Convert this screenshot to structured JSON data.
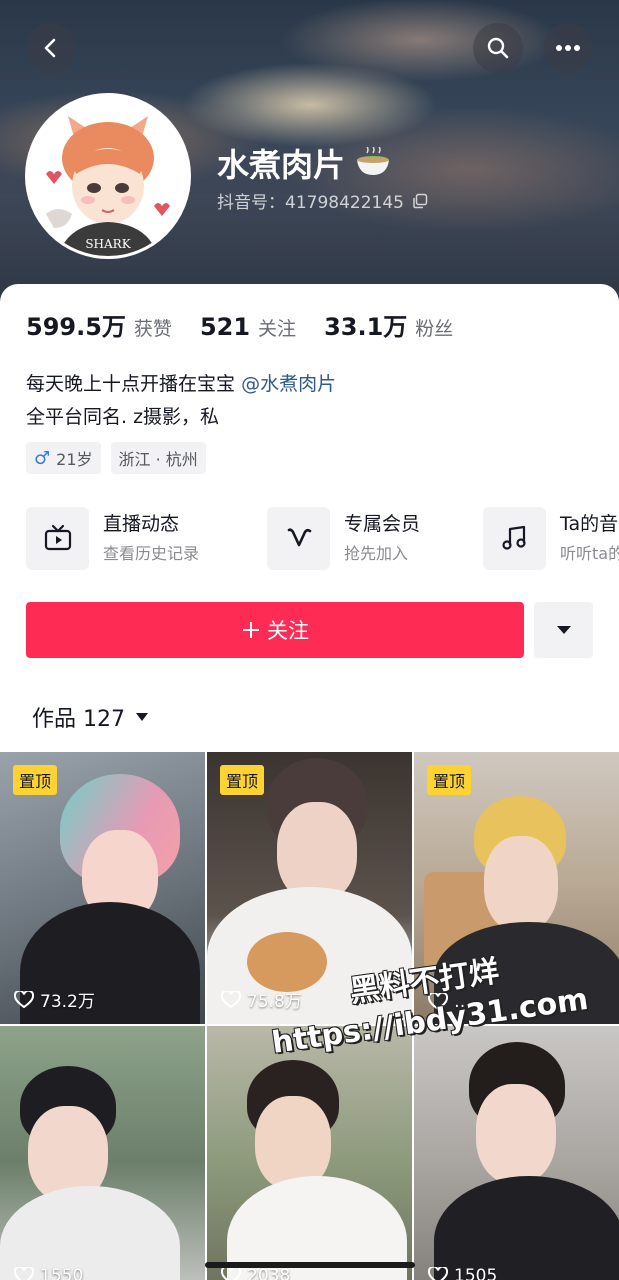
{
  "header": {
    "back_icon": "chevron-left-icon",
    "search_icon": "search-icon",
    "more_icon": "ellipsis-icon"
  },
  "profile": {
    "nickname": "水煮肉片",
    "douyin_id": "抖音号：41798422145",
    "avatar_text": "SHARK"
  },
  "stats": [
    {
      "value": "599.5万",
      "label": "获赞"
    },
    {
      "value": "521",
      "label": "关注"
    },
    {
      "value": "33.1万",
      "label": "粉丝"
    }
  ],
  "bio": {
    "line1_text": "每天晚上十点开播在宝宝",
    "line1_mention": "@水煮肉片",
    "line2": "全平台同名. z摄影，私"
  },
  "tags": [
    {
      "icon": "male-icon",
      "text": "21岁"
    },
    {
      "text": "浙江 · 杭州"
    }
  ],
  "features": [
    {
      "icon": "tv-icon",
      "title": "直播动态",
      "sub": "查看历史记录"
    },
    {
      "icon": "vip-icon",
      "title": "专属会员",
      "sub": "抢先加入"
    },
    {
      "icon": "music-note-icon",
      "title": "Ta的音乐",
      "sub": "听听ta的"
    }
  ],
  "actions": {
    "follow_label": "关注",
    "dropdown_icon": "caret-down-icon"
  },
  "works_tab": {
    "label": "作品 127"
  },
  "videos": [
    {
      "pinned": "置顶",
      "likes": "73.2万"
    },
    {
      "pinned": "置顶",
      "likes": "75.8万"
    },
    {
      "pinned": "置顶",
      "likes": "…"
    },
    {
      "likes": "1550"
    },
    {
      "likes": "2038"
    },
    {
      "likes": "1505"
    }
  ],
  "watermark": {
    "line1": "黑料不打烊",
    "line2": "https://ibdy31.com"
  },
  "colors": {
    "accent": "#fe2c55",
    "pin_badge": "#fdd333",
    "mention": "#2f5a8f"
  }
}
